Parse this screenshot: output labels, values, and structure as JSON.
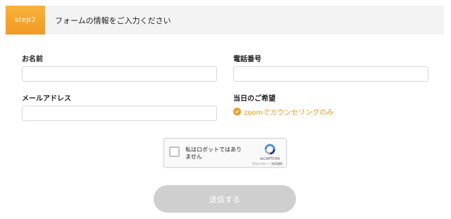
{
  "header": {
    "step_badge": "step2",
    "title": "フォームの情報をご入力ください"
  },
  "form": {
    "name_label": "お名前",
    "name_value": "",
    "phone_label": "電話番号",
    "phone_value": "",
    "email_label": "メールアドレス",
    "email_value": "",
    "date_label": "当日のご希望",
    "date_option": "zoomでカウンセリングのみ",
    "date_option_icon": "check-circle-icon"
  },
  "recaptcha": {
    "label": "私はロボットではありません",
    "brand": "reCAPTCHA",
    "links": "プライバシー・利用規約"
  },
  "submit": {
    "label": "送信する"
  },
  "colors": {
    "accent": "#f29a24",
    "header_bg": "#f3f3f3",
    "button_disabled": "#cfcfcf"
  }
}
